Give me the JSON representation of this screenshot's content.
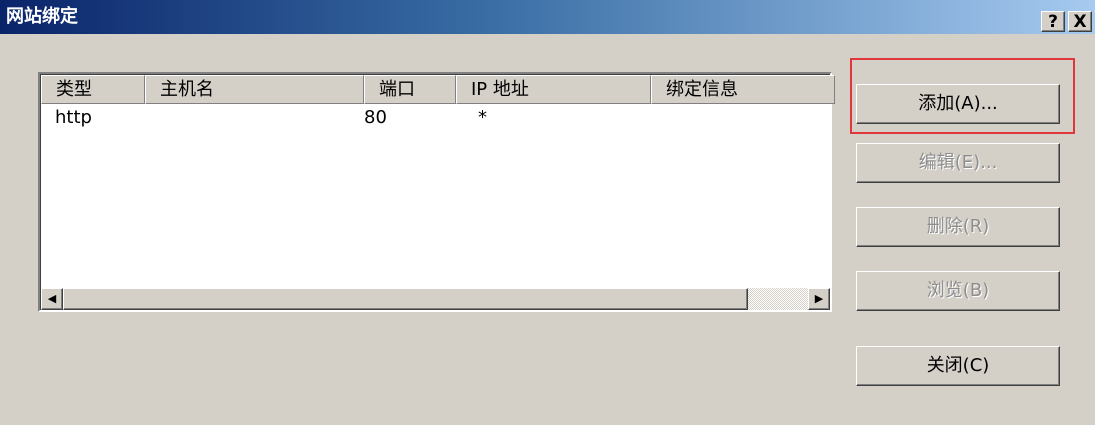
{
  "window": {
    "title": "网站绑定",
    "help_glyph": "?",
    "close_glyph": "X"
  },
  "list": {
    "columns": [
      "类型",
      "主机名",
      "端口",
      "IP 地址",
      "绑定信息"
    ],
    "rows": [
      {
        "type": "http",
        "host": "",
        "port": "80",
        "ip": "*",
        "binding": ""
      }
    ],
    "scroll_left_glyph": "◀",
    "scroll_right_glyph": "▶"
  },
  "buttons": {
    "add": "添加(A)...",
    "edit": "编辑(E)...",
    "delete": "删除(R)",
    "browse": "浏览(B)",
    "close": "关闭(C)"
  },
  "colors": {
    "highlight_border": "#e0373d",
    "title_gradient_start": "#0a246a",
    "title_gradient_end": "#a6caf0",
    "face": "#d4d0c8",
    "disabled_text": "#8d8d8d"
  }
}
